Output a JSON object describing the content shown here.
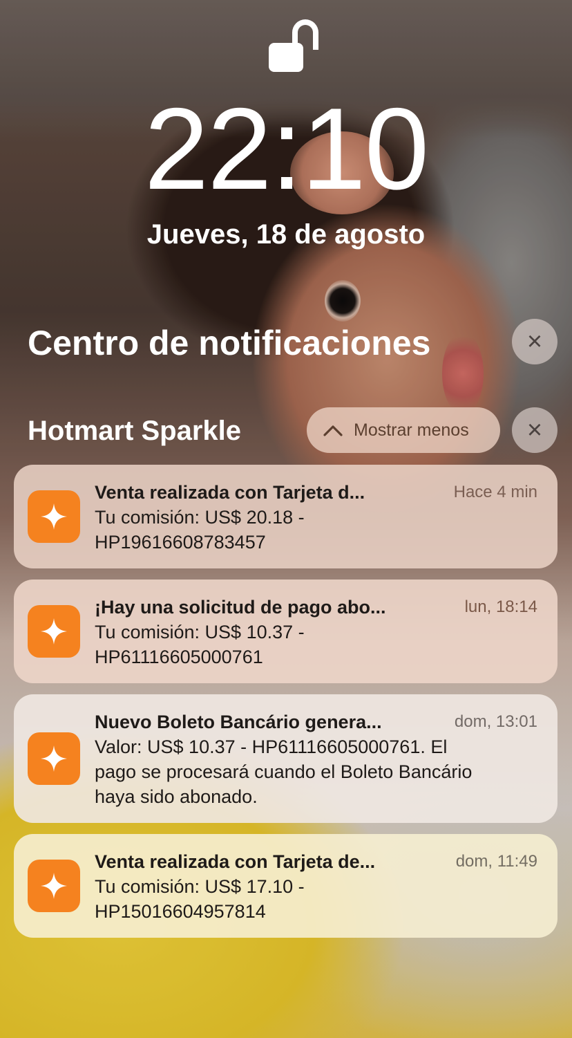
{
  "lockscreen": {
    "time": "22:10",
    "date": "Jueves, 18 de agosto"
  },
  "notification_center": {
    "title": "Centro de notificaciones",
    "close_label": "×"
  },
  "group": {
    "app_name": "Hotmart Sparkle",
    "show_less_label": "Mostrar menos",
    "close_label": "×",
    "app_icon_color": "#f5821f"
  },
  "notifications": [
    {
      "title": "Venta realizada con Tarjeta d...",
      "time": "Hace 4 min",
      "body_lines": [
        "Tu comisión: US$ 20.18 -",
        "HP19616608783457"
      ]
    },
    {
      "title": "¡Hay una solicitud de pago abo...",
      "time": "lun, 18:14",
      "body_lines": [
        "Tu comisión: US$ 10.37 -",
        "HP61116605000761"
      ]
    },
    {
      "title": "Nuevo Boleto Bancário genera...",
      "time": "dom, 13:01",
      "body_lines": [
        "Valor: US$ 10.37 - HP61116605000761. El",
        "pago se procesará cuando el Boleto Bancário",
        "haya sido abonado."
      ]
    },
    {
      "title": "Venta realizada con Tarjeta de...",
      "time": "dom, 11:49",
      "body_lines": [
        "Tu comisión: US$ 17.10 -",
        "HP15016604957814"
      ]
    }
  ]
}
